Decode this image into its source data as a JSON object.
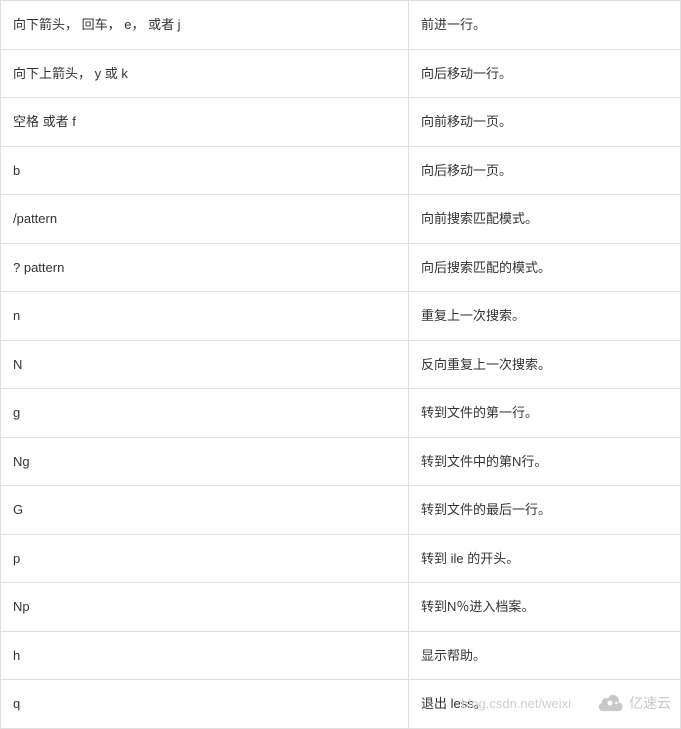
{
  "table": {
    "rows": [
      {
        "key": "向下箭头， 回车， e， 或者 j",
        "desc": "前进一行。"
      },
      {
        "key": "向下上箭头， y 或 k",
        "desc": "向后移动一行。"
      },
      {
        "key": "空格 或者 f",
        "desc": "向前移动一页。"
      },
      {
        "key": "b",
        "desc": "向后移动一页。"
      },
      {
        "key": "/pattern",
        "desc": "向前搜索匹配模式。"
      },
      {
        "key": "? pattern",
        "desc": "向后搜索匹配的模式。"
      },
      {
        "key": "n",
        "desc": "重复上一次搜索。"
      },
      {
        "key": "N",
        "desc": "反向重复上一次搜索。"
      },
      {
        "key": "g",
        "desc": "转到文件的第一行。"
      },
      {
        "key": "Ng",
        "desc": "转到文件中的第N行。"
      },
      {
        "key": "G",
        "desc": "转到文件的最后一行。"
      },
      {
        "key": "p",
        "desc": "转到 ile 的开头。"
      },
      {
        "key": "Np",
        "desc": "转到N％进入档案。"
      },
      {
        "key": "h",
        "desc": "显示帮助。"
      },
      {
        "key": "q",
        "desc": "退出 less。"
      }
    ]
  },
  "watermark": {
    "url": "blog.csdn.net/weixi",
    "logo_text": "亿速云"
  }
}
